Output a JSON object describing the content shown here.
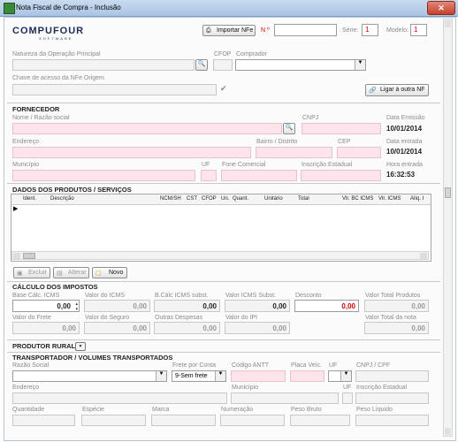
{
  "window": {
    "title": "Nota Fiscal de Compra - Inclusão",
    "close_label": "✕"
  },
  "logo": {
    "text": "COMPUFOUR",
    "subtitle": "SOFTWARE"
  },
  "header": {
    "import_label": "Importar NFe",
    "nro_label": "N º",
    "nro_value": "",
    "serie_label": "Série:",
    "serie_value": "1",
    "modelo_label": "Modelo:",
    "modelo_value": "1"
  },
  "operacao": {
    "label": "Natureza da Operação Principal",
    "value": ""
  },
  "cfop": {
    "label": "CFOP",
    "value": ""
  },
  "comprador": {
    "label": "Comprador",
    "value": ""
  },
  "chave": {
    "label": "Chave de acesso da NFe Origem",
    "value": "",
    "link_label": "Ligar à outra NF"
  },
  "fornecedor": {
    "section": "FORNECEDOR",
    "nome_label": "Nome / Razão social",
    "cnpj_label": "CNPJ",
    "data_emissao_label": "Data Emissão",
    "data_emissao_value": "10/01/2014",
    "endereco_label": "Endereço",
    "bairro_label": "Bairro / Distrito",
    "cep_label": "CEP",
    "data_entrada_label": "Data entrada",
    "data_entrada_value": "10/01/2014",
    "municipio_label": "Município",
    "uf_label": "UF",
    "fone_label": "Fone Comercial",
    "ie_label": "Inscrição Estadual",
    "hora_entrada_label": "Hora entrada",
    "hora_entrada_value": "16:32:53"
  },
  "produtos": {
    "section": "DADOS DOS PRODUTOS / SERVIÇOS",
    "columns": [
      "Ident.",
      "Descrição",
      "NCM/SH",
      "CST",
      "CFOP",
      "Un.",
      "Quant.",
      "Unitário",
      "Total",
      "Vlr. BC ICMS",
      "Vlr. ICMS",
      "Alíq. I"
    ],
    "row_marker": "▶",
    "excluir_label": "Excluir",
    "alterar_label": "Alterar",
    "novo_label": "Novo"
  },
  "impostos": {
    "section": "CÁLCULO DOS IMPOSTOS",
    "base_icms_label": "Base Cálc. ICMS",
    "base_icms_value": "0,00",
    "valor_icms_label": "Valor do ICMS",
    "valor_icms_value": "0,00",
    "bc_subst_label": "B.Cálc ICMS subst.",
    "bc_subst_value": "0,00",
    "icms_subst_label": "Valor ICMS Subst.",
    "icms_subst_value": "0,00",
    "desconto_label": "Desconto",
    "desconto_value": "0,00",
    "total_produtos_label": "Valor Total Produtos",
    "total_produtos_value": "0,00",
    "frete_label": "Valor do Frete",
    "frete_value": "0,00",
    "seguro_label": "Valor do Seguro",
    "seguro_value": "0,00",
    "outras_label": "Outras Despesas",
    "outras_value": "0,00",
    "ipi_label": "Valor do IPI",
    "ipi_value": "0,00",
    "total_nota_label": "Valor Total da nota",
    "total_nota_value": "0,00"
  },
  "produtor": {
    "section": "PRODUTOR RURAL"
  },
  "transporte": {
    "section": "TRANSPORTADOR / VOLUMES TRANSPORTADOS",
    "razao_label": "Razão Social",
    "frete_conta_label": "Frete por Conta",
    "frete_conta_value": "9-Sem frete",
    "antt_label": "Código ANTT",
    "placa_label": "Placa Veíc.",
    "uf_label": "UF",
    "cnpj_label": "CNPJ / CPF",
    "endereco_label": "Endereço",
    "municipio_label": "Município",
    "uf2_label": "UF",
    "ie_label": "Inscrição Estadual",
    "quantidade_label": "Quantidade",
    "especie_label": "Espécie",
    "marca_label": "Marca",
    "numeracao_label": "Numeração",
    "peso_bruto_label": "Peso Bruto",
    "peso_liquido_label": "Peso Líquido"
  },
  "colors": {
    "pink_field": "#fde4ea",
    "required_red": "#d40000",
    "title_blue": "#a9c4e3"
  }
}
